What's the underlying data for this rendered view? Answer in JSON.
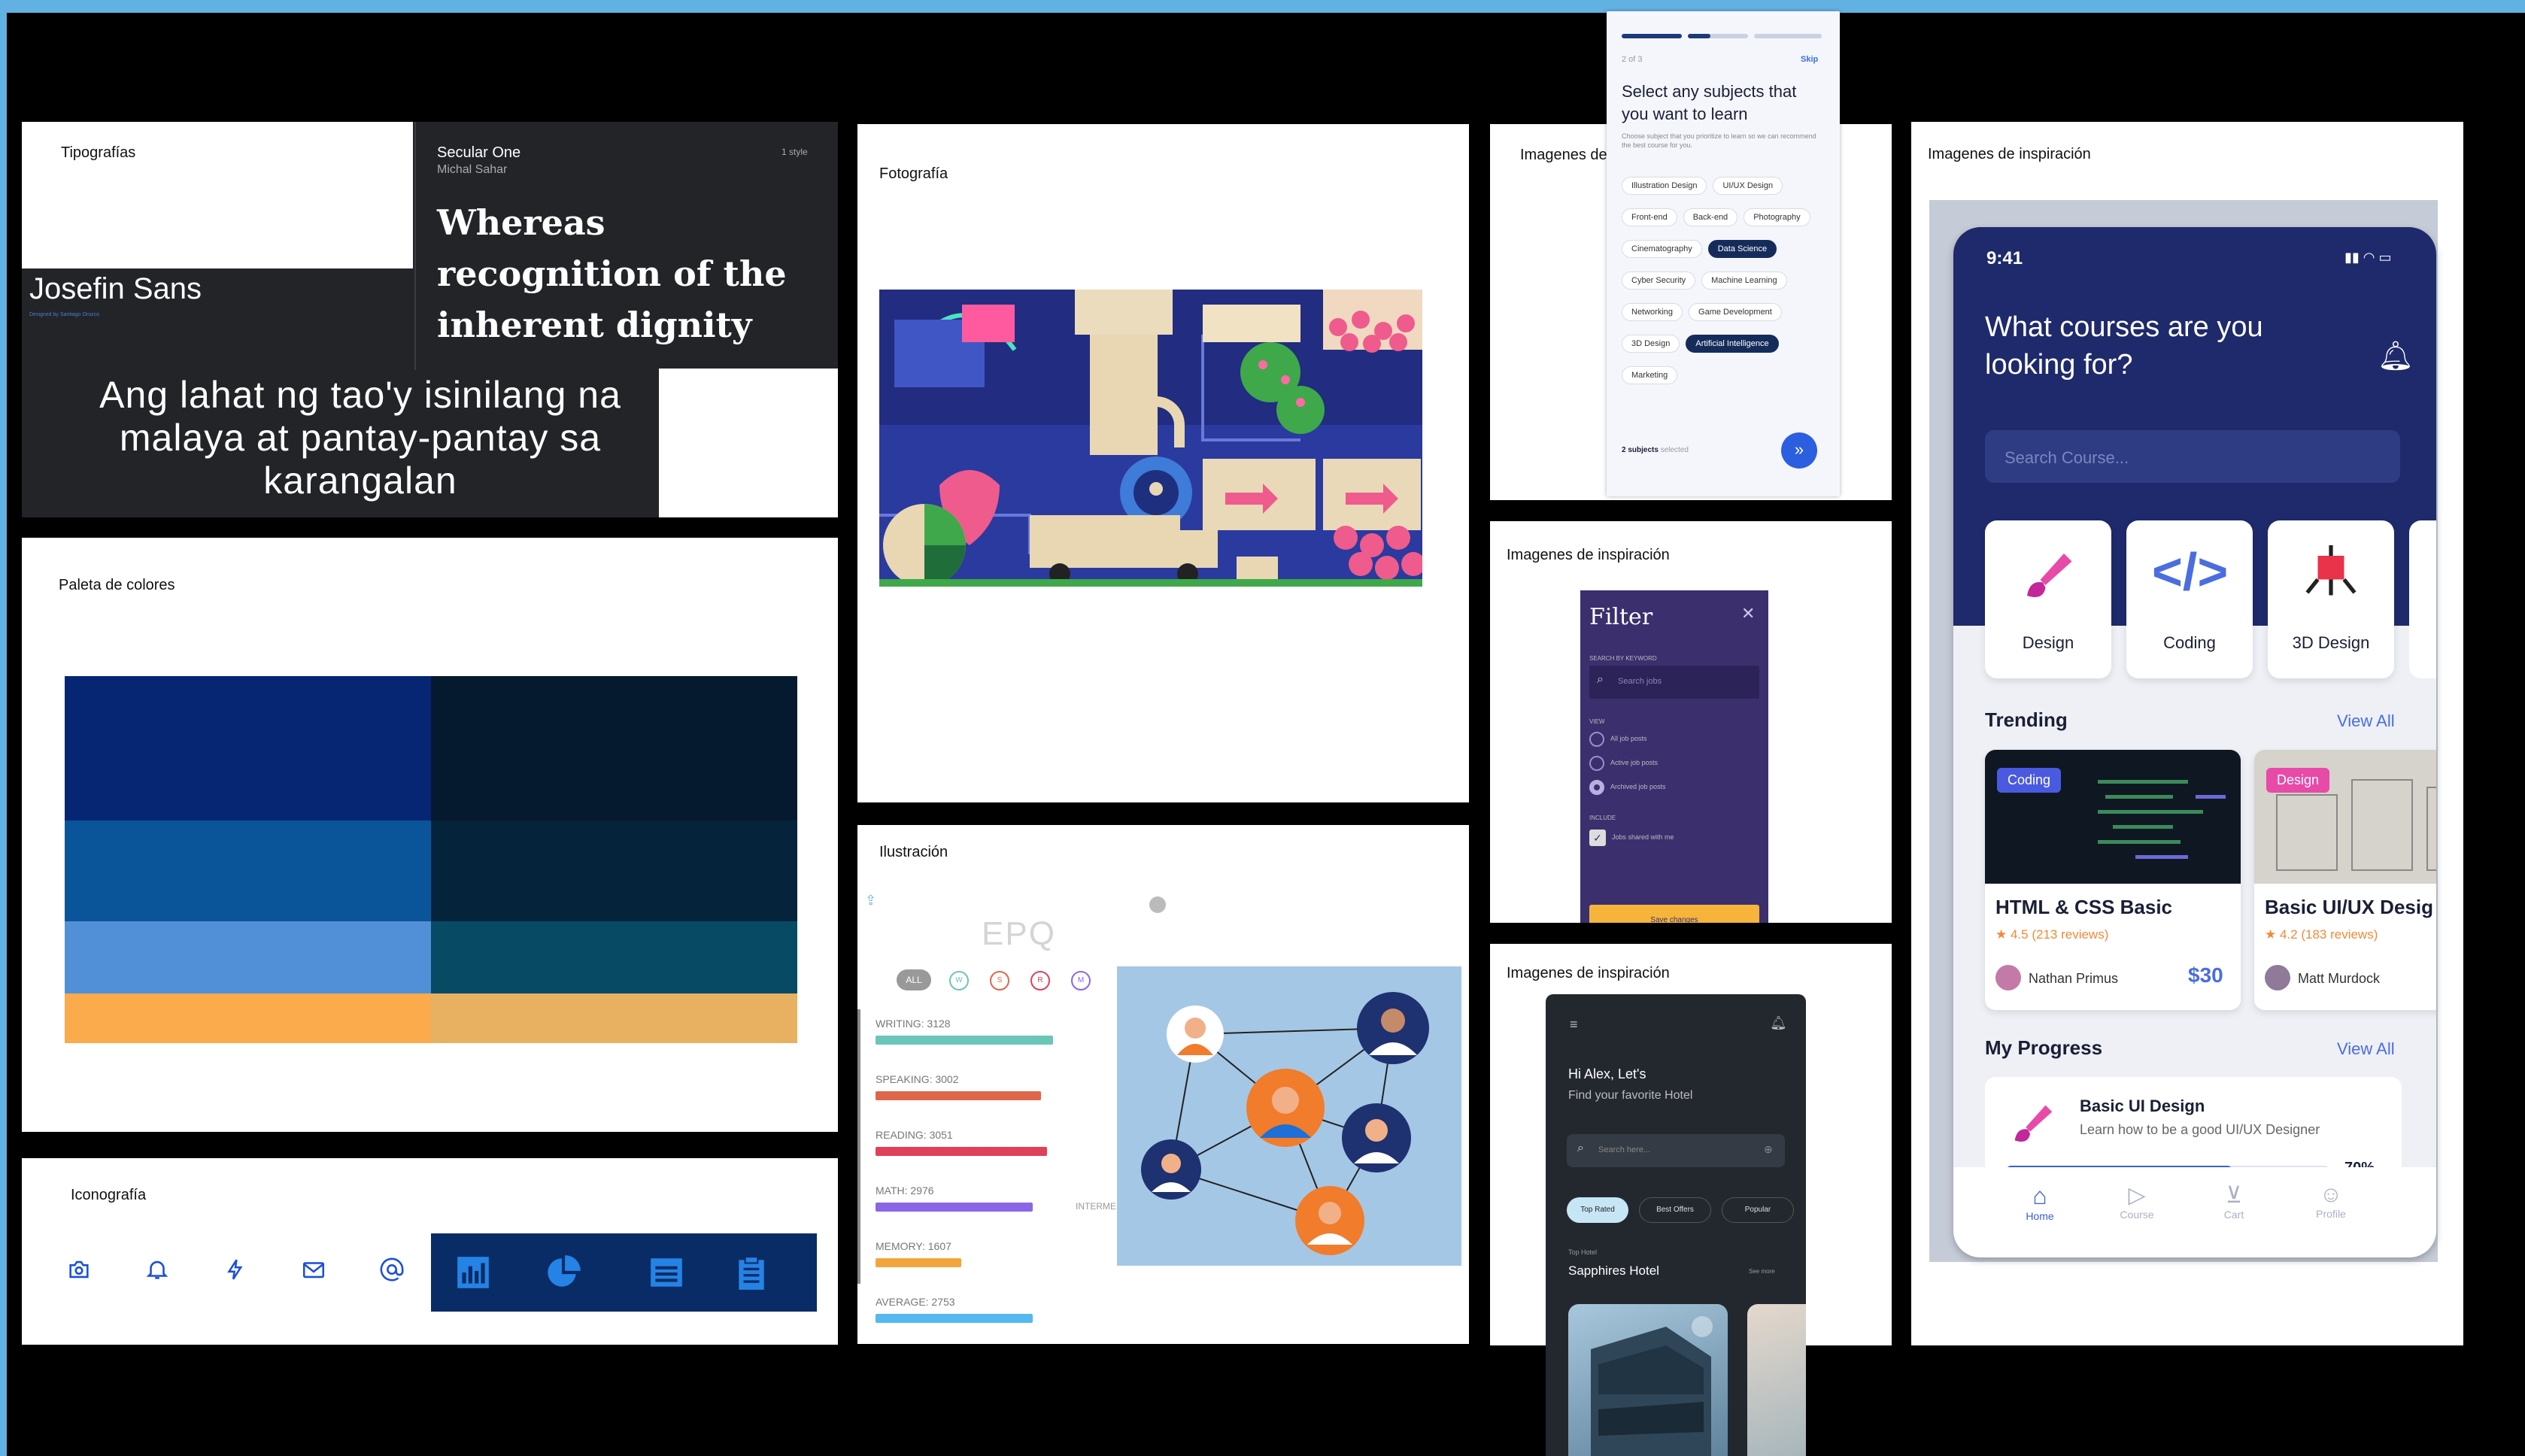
{
  "typography": {
    "label": "Tipografías",
    "font1_name": "Josefin Sans",
    "font1_designer": "Designed by Santiago Orozco",
    "font2_name": "Secular One",
    "font2_designer": "Michal Sahar",
    "font2_styles": "1 style",
    "sample_en": "Whereas recognition of the inherent dignity",
    "sample_tl": "Ang lahat ng tao'y isinilang na malaya at pantay-pantay sa karangalan"
  },
  "palette": {
    "label": "Paleta de colores",
    "colors": [
      "#062674",
      "#061a2f",
      "#0a5599",
      "#05233a",
      "#5190d6",
      "#074a63",
      "#fbaa4c",
      "#e8b061"
    ]
  },
  "iconography": {
    "label": "Iconografía",
    "icons": [
      "camera-icon",
      "bell-icon",
      "bolt-icon",
      "mail-icon",
      "at-icon",
      "bar-chart-icon",
      "pie-chart-icon",
      "film-icon",
      "clipboard-icon"
    ]
  },
  "photography": {
    "label": "Fotografía"
  },
  "illustration": {
    "label": "Ilustración",
    "app_title": "EPQ",
    "filter_all": "ALL",
    "filters": [
      "W",
      "S",
      "R",
      "M"
    ],
    "stats": [
      {
        "label": "WRITING: 3128",
        "color": "#6ac6b8",
        "fill": 0.62
      },
      {
        "label": "SPEAKING: 3002",
        "color": "#e0664a",
        "fill": 0.58
      },
      {
        "label": "READING: 3051",
        "color": "#e0405a",
        "fill": 0.6
      },
      {
        "label": "MATH: 2976",
        "color": "#8a67e6",
        "fill": 0.55
      },
      {
        "label": "MEMORY: 1607",
        "color": "#f2a53c",
        "fill": 0.3
      },
      {
        "label": "AVERAGE: 2753",
        "color": "#55b8f0",
        "fill": 0.55
      }
    ],
    "level_label": "INTERMEDIATE"
  },
  "inspo1": {
    "label": "Imagenes de inspiración",
    "step": "2 of 3",
    "skip": "Skip",
    "title": "Select any subjects that you want to learn",
    "subtitle": "Choose subject that you prioritize to learn so we can recommend the best course for you.",
    "chips": [
      {
        "text": "Illustration Design",
        "selected": false
      },
      {
        "text": "UI/UX Design",
        "selected": false
      },
      {
        "text": "Front-end",
        "selected": false
      },
      {
        "text": "Back-end",
        "selected": false
      },
      {
        "text": "Photography",
        "selected": false
      },
      {
        "text": "Cinematography",
        "selected": false
      },
      {
        "text": "Data Science",
        "selected": true
      },
      {
        "text": "Cyber Security",
        "selected": false
      },
      {
        "text": "Machine Learning",
        "selected": false
      },
      {
        "text": "Networking",
        "selected": false
      },
      {
        "text": "Game Development",
        "selected": false
      },
      {
        "text": "3D Design",
        "selected": false
      },
      {
        "text": "Artificial Intelligence",
        "selected": true
      },
      {
        "text": "Marketing",
        "selected": false
      }
    ],
    "count": "2 subjects",
    "count_suffix": "selected"
  },
  "inspo2": {
    "label": "Imagenes de inspiración",
    "title": "Filter",
    "search_label": "SEARCH BY KEYWORD",
    "search_placeholder": "Search jobs",
    "view_label": "VIEW",
    "options": [
      "All job posts",
      "Active job posts",
      "Archived job posts"
    ],
    "include_label": "INCLUDE",
    "include_option": "Jobs shared with me",
    "save": "Save changes"
  },
  "inspo3": {
    "label": "Imagenes de inspiración",
    "greeting": "Hi Alex, Let's",
    "subgreeting": "Find your favorite Hotel",
    "search_placeholder": "Search here...",
    "tabs": [
      "Top Rated",
      "Best Offers",
      "Popular"
    ],
    "section": "Top Hotel",
    "hotel": "Sapphires Hotel",
    "see_more": "See more"
  },
  "inspo4": {
    "label": "Imagenes de inspiración",
    "time": "9:41",
    "heading": "What courses are you looking for?",
    "search_placeholder": "Search Course...",
    "categories": [
      "Design",
      "Coding",
      "3D Design"
    ],
    "trending": "Trending",
    "view_all": "View All",
    "course1": {
      "tag": "Coding",
      "title": "HTML & CSS Basic",
      "rating": "4.5 (213 reviews)",
      "author": "Nathan Primus",
      "price": "$30"
    },
    "course2": {
      "tag": "Design",
      "title": "Basic UI/UX Desig",
      "rating": "4.2 (183 reviews)",
      "author": "Matt Murdock"
    },
    "progress_title": "My Progress",
    "progress_course": "Basic UI Design",
    "progress_desc": "Learn how to be a good UI/UX Designer",
    "progress_pct": "70%",
    "progress_value": 0.7,
    "nav": [
      "Home",
      "Course",
      "Cart",
      "Profile"
    ]
  }
}
